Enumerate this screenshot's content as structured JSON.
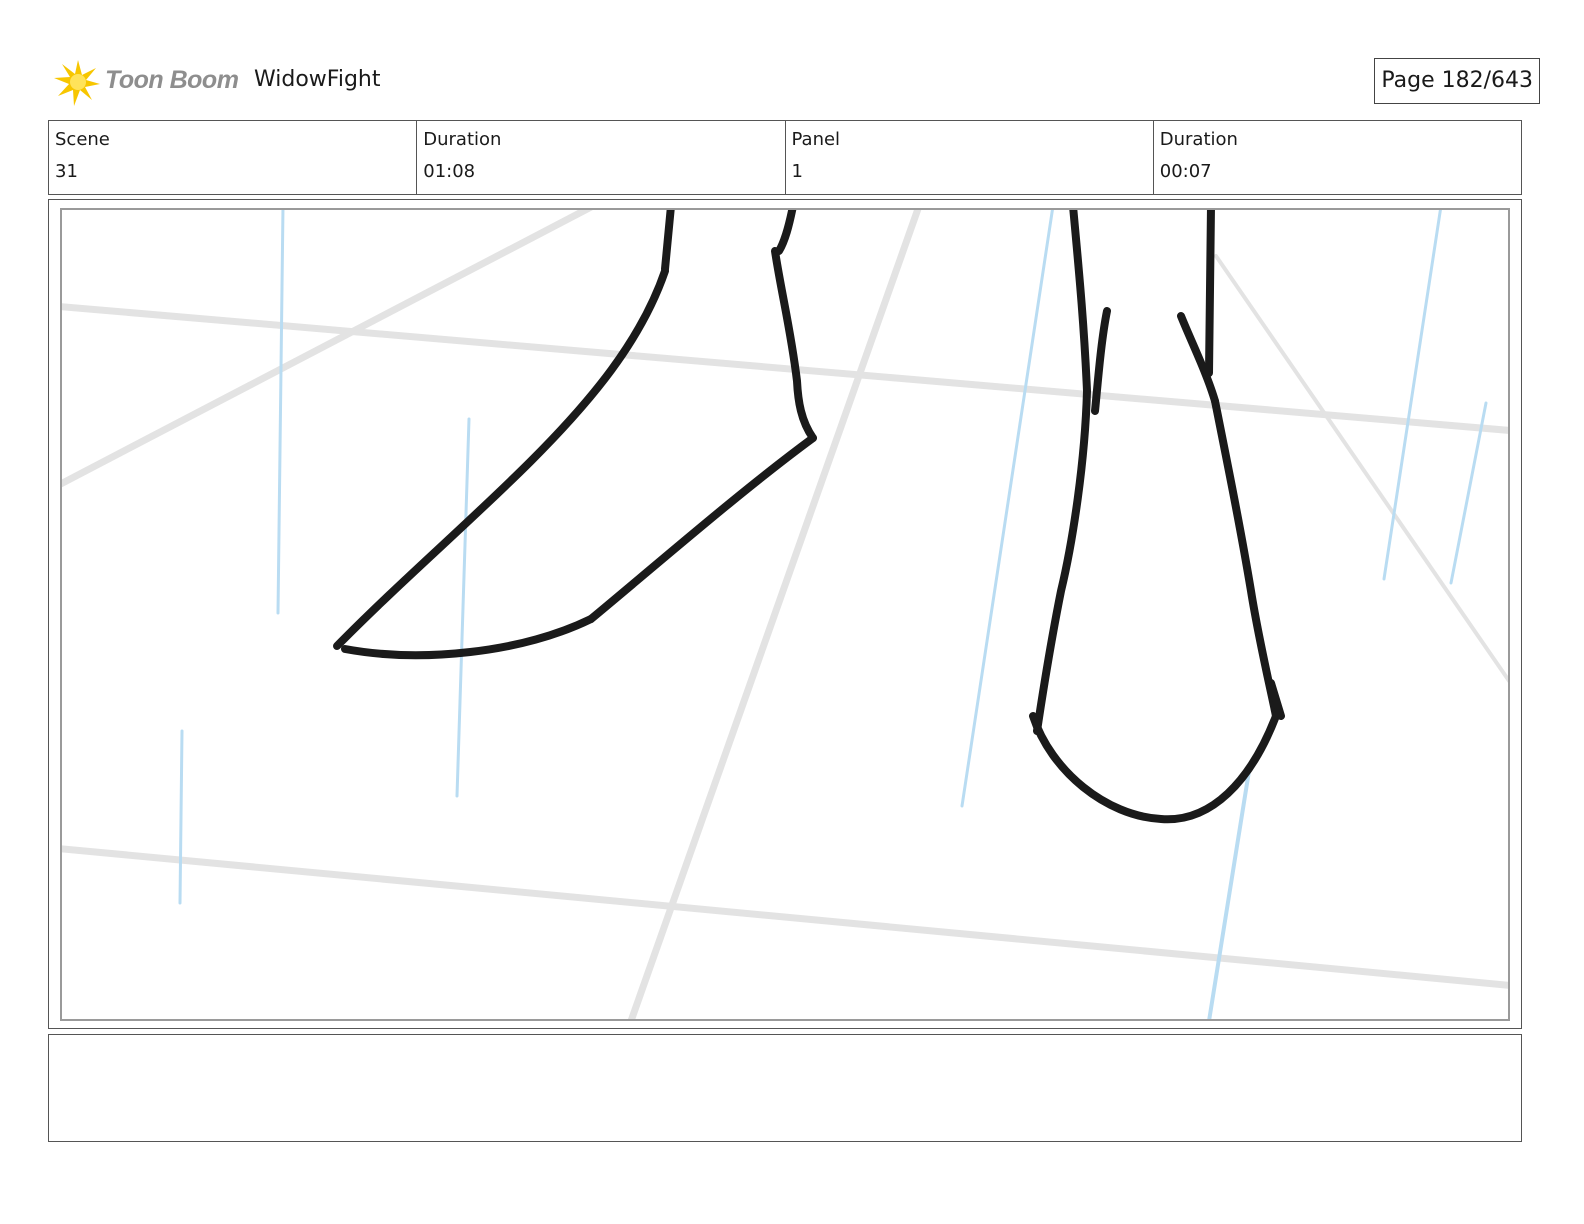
{
  "header": {
    "logo_text": "Toon Boom",
    "project_title": "WidowFight",
    "page_counter": "Page 182/643"
  },
  "info": {
    "scene_label": "Scene",
    "scene_value": "31",
    "scene_duration_label": "Duration",
    "scene_duration_value": "01:08",
    "panel_label": "Panel",
    "panel_value": "1",
    "panel_duration_label": "Duration",
    "panel_duration_value": "00:07"
  },
  "notes": {
    "text": ""
  },
  "colors": {
    "logo_star": "#f7c600",
    "logo_star_inner": "#ffe35a",
    "logo_text": "#8e8e8e",
    "sketch_ink": "#1a1a1a",
    "grid_lines": "#e3e3e3",
    "rain_lines": "#b9dcf2"
  },
  "icons": {
    "logo": "toon-boom-star-icon"
  }
}
